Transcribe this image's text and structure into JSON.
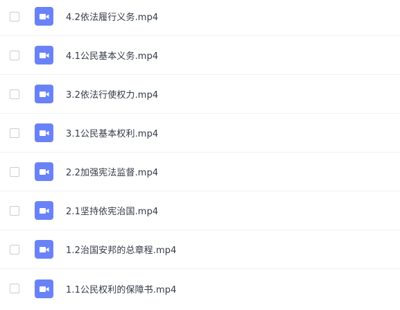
{
  "file_list": {
    "icon": "video-file-icon",
    "icon_color": "#6a82f7",
    "items": [
      {
        "name": "4.2依法履行义务.mp4",
        "checked": false
      },
      {
        "name": "4.1公民基本义务.mp4",
        "checked": false
      },
      {
        "name": "3.2依法行使权力.mp4",
        "checked": false
      },
      {
        "name": "3.1公民基本权利.mp4",
        "checked": false
      },
      {
        "name": "2.2加强宪法监督.mp4",
        "checked": false
      },
      {
        "name": "2.1坚持依宪治国.mp4",
        "checked": false
      },
      {
        "name": "1.2治国安邦的总章程.mp4",
        "checked": false
      },
      {
        "name": "1.1公民权利的保障书.mp4",
        "checked": false
      }
    ]
  }
}
